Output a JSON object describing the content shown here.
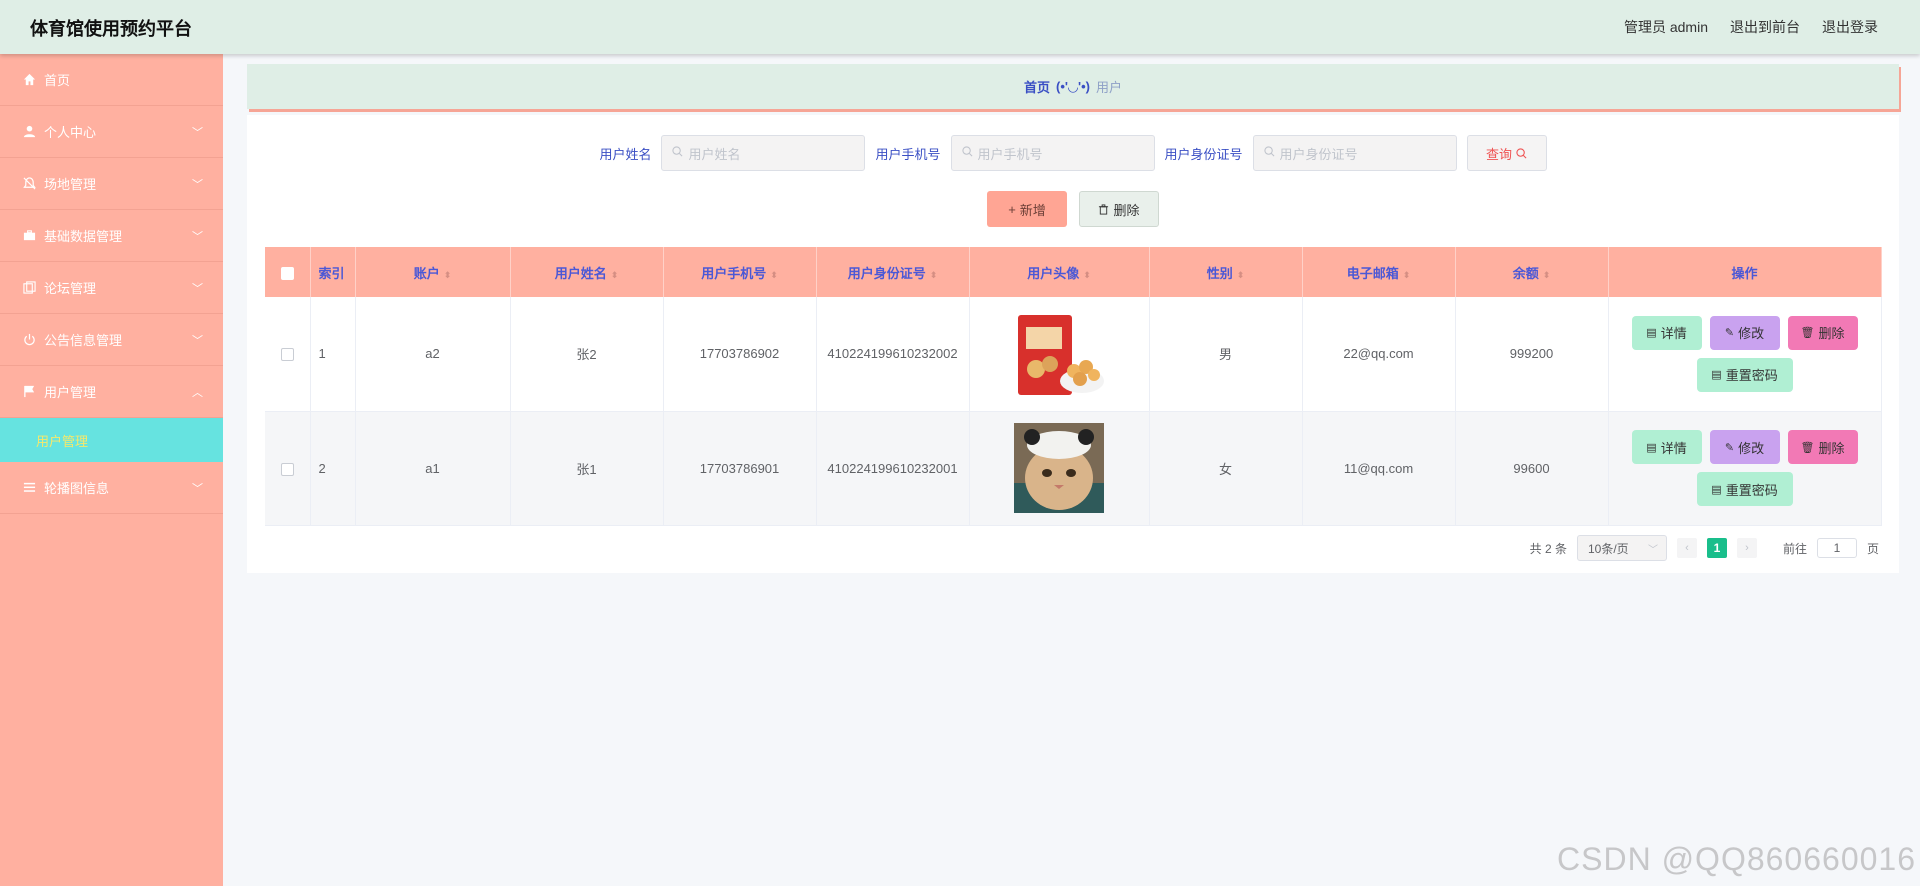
{
  "header": {
    "title": "体育馆使用预约平台",
    "admin_label": "管理员 admin",
    "exit_front": "退出到前台",
    "logout": "退出登录"
  },
  "sidebar": {
    "items": [
      {
        "label": "首页",
        "icon": "home-icon"
      },
      {
        "label": "个人中心",
        "icon": "user-icon"
      },
      {
        "label": "场地管理",
        "icon": "bell-icon"
      },
      {
        "label": "基础数据管理",
        "icon": "briefcase-icon"
      },
      {
        "label": "论坛管理",
        "icon": "copy-icon"
      },
      {
        "label": "公告信息管理",
        "icon": "power-icon"
      },
      {
        "label": "用户管理",
        "icon": "flag-icon"
      },
      {
        "label": "轮播图信息",
        "icon": "list-icon"
      }
    ],
    "active_sub": "用户管理"
  },
  "breadcrumb": {
    "home": "首页",
    "face": "(•'◡'•)",
    "current": "用户"
  },
  "search": {
    "name_label": "用户姓名",
    "name_placeholder": "用户姓名",
    "phone_label": "用户手机号",
    "phone_placeholder": "用户手机号",
    "idcard_label": "用户身份证号",
    "idcard_placeholder": "用户身份证号",
    "query_label": "查询"
  },
  "actions": {
    "add": "新增",
    "delete": "删除"
  },
  "table": {
    "headers": [
      "索引",
      "账户",
      "用户姓名",
      "用户手机号",
      "用户身份证号",
      "用户头像",
      "性别",
      "电子邮箱",
      "余额",
      "操作"
    ],
    "rows": [
      {
        "index": "1",
        "account": "a2",
        "name": "张2",
        "phone": "17703786902",
        "idcard": "410224199610232002",
        "gender": "男",
        "email": "22@qq.com",
        "balance": "999200"
      },
      {
        "index": "2",
        "account": "a1",
        "name": "张1",
        "phone": "17703786901",
        "idcard": "410224199610232001",
        "gender": "女",
        "email": "11@qq.com",
        "balance": "99600"
      }
    ],
    "ops": {
      "detail": "详情",
      "edit": "修改",
      "remove": "删除",
      "reset": "重置密码"
    }
  },
  "pagination": {
    "total": "共 2 条",
    "page_size": "10条/页",
    "current": "1",
    "goto_label": "前往",
    "goto_value": "1",
    "page_suffix": "页"
  },
  "watermark": "CSDN @QQ860660016"
}
